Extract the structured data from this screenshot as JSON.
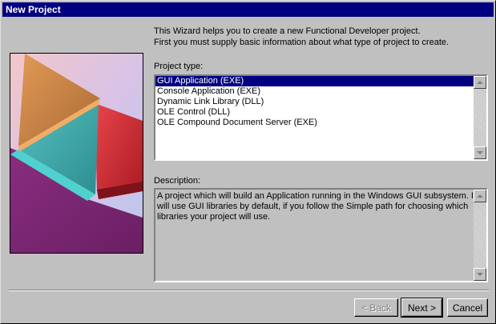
{
  "window": {
    "title": "New Project"
  },
  "intro": {
    "line1": "This Wizard helps you to create a new Functional Developer project.",
    "line2": "First you must supply basic information about what type of project to create."
  },
  "project_type": {
    "label": "Project type:",
    "items": [
      {
        "label": "GUI Application (EXE)",
        "selected": true
      },
      {
        "label": "Console Application (EXE)",
        "selected": false
      },
      {
        "label": "Dynamic Link Library (DLL)",
        "selected": false
      },
      {
        "label": "OLE Control (DLL)",
        "selected": false
      },
      {
        "label": "OLE Compound Document Server (EXE)",
        "selected": false
      }
    ]
  },
  "description": {
    "label": "Description:",
    "lines": [
      "A project which will build an Application running in the Windows GUI subsystem.  It",
      "will use GUI libraries by default, if you follow the Simple path for choosing which",
      "libraries your project will use."
    ]
  },
  "buttons": {
    "back": "< Back",
    "next": "Next >",
    "cancel": "Cancel"
  },
  "colors": {
    "title_bar": "#000080",
    "selection": "#000080",
    "face": "#c0c0c0"
  }
}
